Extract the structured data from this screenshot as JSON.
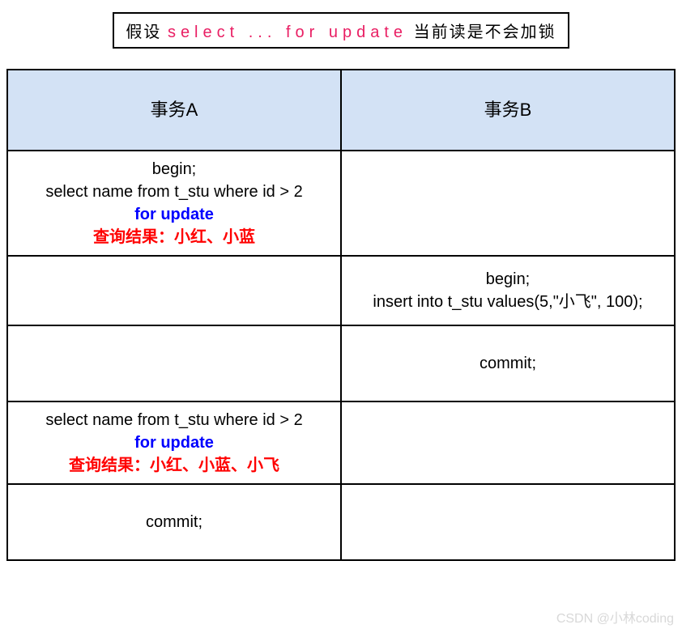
{
  "assumption": {
    "prefix": "假设 ",
    "code": "select ... for update",
    "suffix": " 当前读是不会加锁"
  },
  "headers": {
    "colA": "事务A",
    "colB": "事务B"
  },
  "rows": {
    "r1a_line1": "begin;",
    "r1a_line2": "select name from t_stu where id > 2",
    "r1a_line3": "for update",
    "r1a_line4": "查询结果：小红、小蓝",
    "r1b": "",
    "r2a": "",
    "r2b_line1": "begin;",
    "r2b_line2": "insert into t_stu values(5,\"小飞\", 100);",
    "r3a": "",
    "r3b": "commit;",
    "r4a_line1": "select name from t_stu where id > 2",
    "r4a_line2": "for update",
    "r4a_line3": "查询结果：小红、小蓝、小飞",
    "r4b": "",
    "r5a": "commit;",
    "r5b": ""
  },
  "watermark": "CSDN @小林coding"
}
